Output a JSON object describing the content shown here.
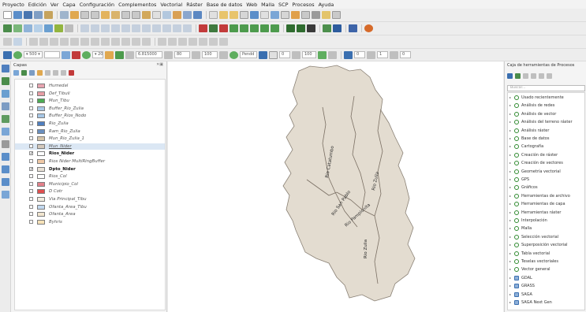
{
  "menu": [
    "Proyecto",
    "Edición",
    "Ver",
    "Capa",
    "Configuración",
    "Complementos",
    "Vectorial",
    "Ráster",
    "Base de datos",
    "Web",
    "Malla",
    "SCP",
    "Procesos",
    "Ayuda"
  ],
  "toolbar4": {
    "field_1": "▾ 500 ▾",
    "field_2": "▾ 200",
    "field_3": "6.815000",
    "field_4": "80",
    "field_5": "100",
    "field_6": "Pendd",
    "field_7": "0",
    "field_8": "100",
    "field_9": "0",
    "field_10": "1",
    "field_11": "0"
  },
  "layers_panel": {
    "title": "Capas",
    "close": "✕▣",
    "items": [
      {
        "label": "Humedal",
        "checked": false,
        "color": "#e8a4b0",
        "style": "italic"
      },
      {
        "label": "Def_Tibuli",
        "checked": false,
        "color": "#e89da5",
        "style": "italic"
      },
      {
        "label": "Mun_Tibu",
        "checked": false,
        "color": "#4cab53",
        "style": "italic"
      },
      {
        "label": "Buffer_Rio_Zulia",
        "checked": false,
        "color": "#a7c7e6",
        "style": "italic"
      },
      {
        "label": "Buffer_Rios_Nodo",
        "checked": false,
        "color": "#a7c7e6",
        "style": "italic"
      },
      {
        "label": "Rio_Zulia",
        "checked": false,
        "color": "#4f7fbf",
        "style": "italic"
      },
      {
        "label": "Ram_Rio_Zulia",
        "checked": false,
        "color": "#6a8fbf",
        "style": "italic"
      },
      {
        "label": "Mun_Rio_Zulia_1",
        "checked": false,
        "color": "#d5c4a8",
        "style": "italic"
      },
      {
        "label": "Mun_Nider",
        "checked": false,
        "color": "#d4c9bd",
        "style": "underline"
      },
      {
        "label": "Rios_Nider",
        "checked": true,
        "color": "#ffffff",
        "style": "bold"
      },
      {
        "label": "Rios Nider MultiRingBuffer",
        "checked": false,
        "color": "#f0c9a6",
        "style": "italic"
      },
      {
        "label": "Dpto_Nider",
        "checked": true,
        "color": "#e9e2d6",
        "style": "bold"
      },
      {
        "label": "Rios_Col",
        "checked": false,
        "color": "#ffffff",
        "style": "italic"
      },
      {
        "label": "Municipio_Col",
        "checked": false,
        "color": "#e3808a",
        "style": "italic"
      },
      {
        "label": "D Cotr",
        "checked": false,
        "color": "#e04f4f",
        "style": "italic"
      },
      {
        "label": "Via Principal_Tibu",
        "checked": false,
        "color": "#f2ede0",
        "style": "italic"
      },
      {
        "label": "Ofanta_Area_Tibu",
        "checked": false,
        "color": "#c2d9f0",
        "style": "italic"
      },
      {
        "label": "Ofanta_Area",
        "checked": false,
        "color": "#f2e6d0",
        "style": "italic"
      },
      {
        "label": "Byhris",
        "checked": false,
        "color": "#f6e2b8",
        "style": "italic"
      }
    ]
  },
  "map": {
    "rivers": [
      "Rio Catatumbo",
      "Rio San Pablo",
      "Rio Pamplonita",
      "Rio Zulia",
      "Rio Zulia"
    ],
    "region_fill": "#e3dcd0",
    "river_color": "#7a6f63"
  },
  "processing_panel": {
    "title": "Caja de herramientas de Procesos",
    "search_placeholder": "Buscar...",
    "items": [
      {
        "label": "Usado recientemente",
        "icon": "clock"
      },
      {
        "label": "Análisis de redes",
        "icon": "q"
      },
      {
        "label": "Análisis de vector",
        "icon": "q"
      },
      {
        "label": "Análisis del terreno ráster",
        "icon": "q"
      },
      {
        "label": "Análisis ráster",
        "icon": "q"
      },
      {
        "label": "Base de datos",
        "icon": "q"
      },
      {
        "label": "Cartografía",
        "icon": "q"
      },
      {
        "label": "Creación de ráster",
        "icon": "q"
      },
      {
        "label": "Creación de vectores",
        "icon": "q"
      },
      {
        "label": "Geometría vectorial",
        "icon": "q"
      },
      {
        "label": "GPS",
        "icon": "q"
      },
      {
        "label": "Gráficos",
        "icon": "q"
      },
      {
        "label": "Herramientas de archivo",
        "icon": "q"
      },
      {
        "label": "Herramientas de capa",
        "icon": "q"
      },
      {
        "label": "Herramientas ráster",
        "icon": "q"
      },
      {
        "label": "Interpolación",
        "icon": "q"
      },
      {
        "label": "Malla",
        "icon": "q"
      },
      {
        "label": "Selección vectorial",
        "icon": "q"
      },
      {
        "label": "Superposición vectorial",
        "icon": "q"
      },
      {
        "label": "Tabla vectorial",
        "icon": "q"
      },
      {
        "label": "Teselas vectoriales",
        "icon": "q"
      },
      {
        "label": "Vector general",
        "icon": "q"
      },
      {
        "label": "GDAL",
        "icon": "gdal"
      },
      {
        "label": "GRASS",
        "icon": "grass"
      },
      {
        "label": "SAGA",
        "icon": "saga"
      },
      {
        "label": "SAGA Next Gen",
        "icon": "saga"
      }
    ]
  }
}
